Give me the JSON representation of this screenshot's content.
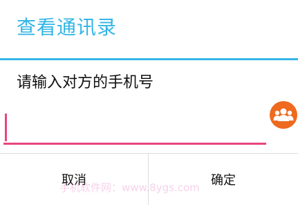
{
  "dialog": {
    "title": "查看通讯录",
    "prompt": "请输入对方的手机号",
    "input": {
      "value": "",
      "placeholder": ""
    },
    "contacts_icon": "contacts-group-icon",
    "buttons": {
      "cancel_label": "取消",
      "confirm_label": "确定"
    }
  },
  "watermark": {
    "text": "手机软件网：www.8ygs.com"
  },
  "colors": {
    "accent": "#33b5e5",
    "input_focus": "#e8457f",
    "contacts_icon_bg": "#ee6a1e"
  }
}
